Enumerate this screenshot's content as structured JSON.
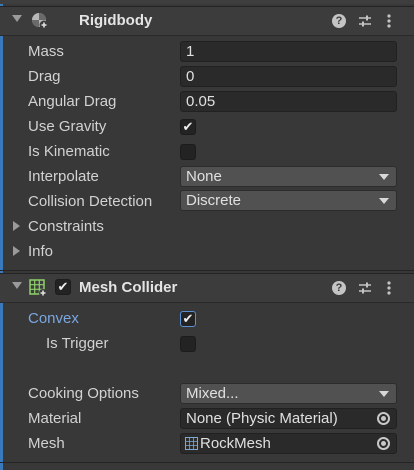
{
  "colors": {
    "accent": "#3a79bb",
    "label_blue": "#7ba6e0"
  },
  "rigidbody": {
    "title": "Rigidbody",
    "fields": {
      "mass_label": "Mass",
      "mass_value": "1",
      "drag_label": "Drag",
      "drag_value": "0",
      "angular_drag_label": "Angular Drag",
      "angular_drag_value": "0.05",
      "use_gravity_label": "Use Gravity",
      "use_gravity_checked": true,
      "is_kinematic_label": "Is Kinematic",
      "is_kinematic_checked": false,
      "interpolate_label": "Interpolate",
      "interpolate_value": "None",
      "collision_label": "Collision Detection",
      "collision_value": "Discrete"
    },
    "constraints_label": "Constraints",
    "info_label": "Info"
  },
  "mesh_collider": {
    "title": "Mesh Collider",
    "enabled": true,
    "convex_label": "Convex",
    "convex_checked": true,
    "is_trigger_label": "Is Trigger",
    "is_trigger_checked": false,
    "cooking_label": "Cooking Options",
    "cooking_value": "Mixed...",
    "material_label": "Material",
    "material_value": "None (Physic Material)",
    "mesh_label": "Mesh",
    "mesh_value": "RockMesh"
  },
  "icons": {
    "help": "help-icon",
    "presets": "presets-sliders-icon",
    "menu": "kebab-menu-icon",
    "rigidbody": "rigidbody-icon",
    "mesh_collider": "mesh-collider-icon"
  }
}
